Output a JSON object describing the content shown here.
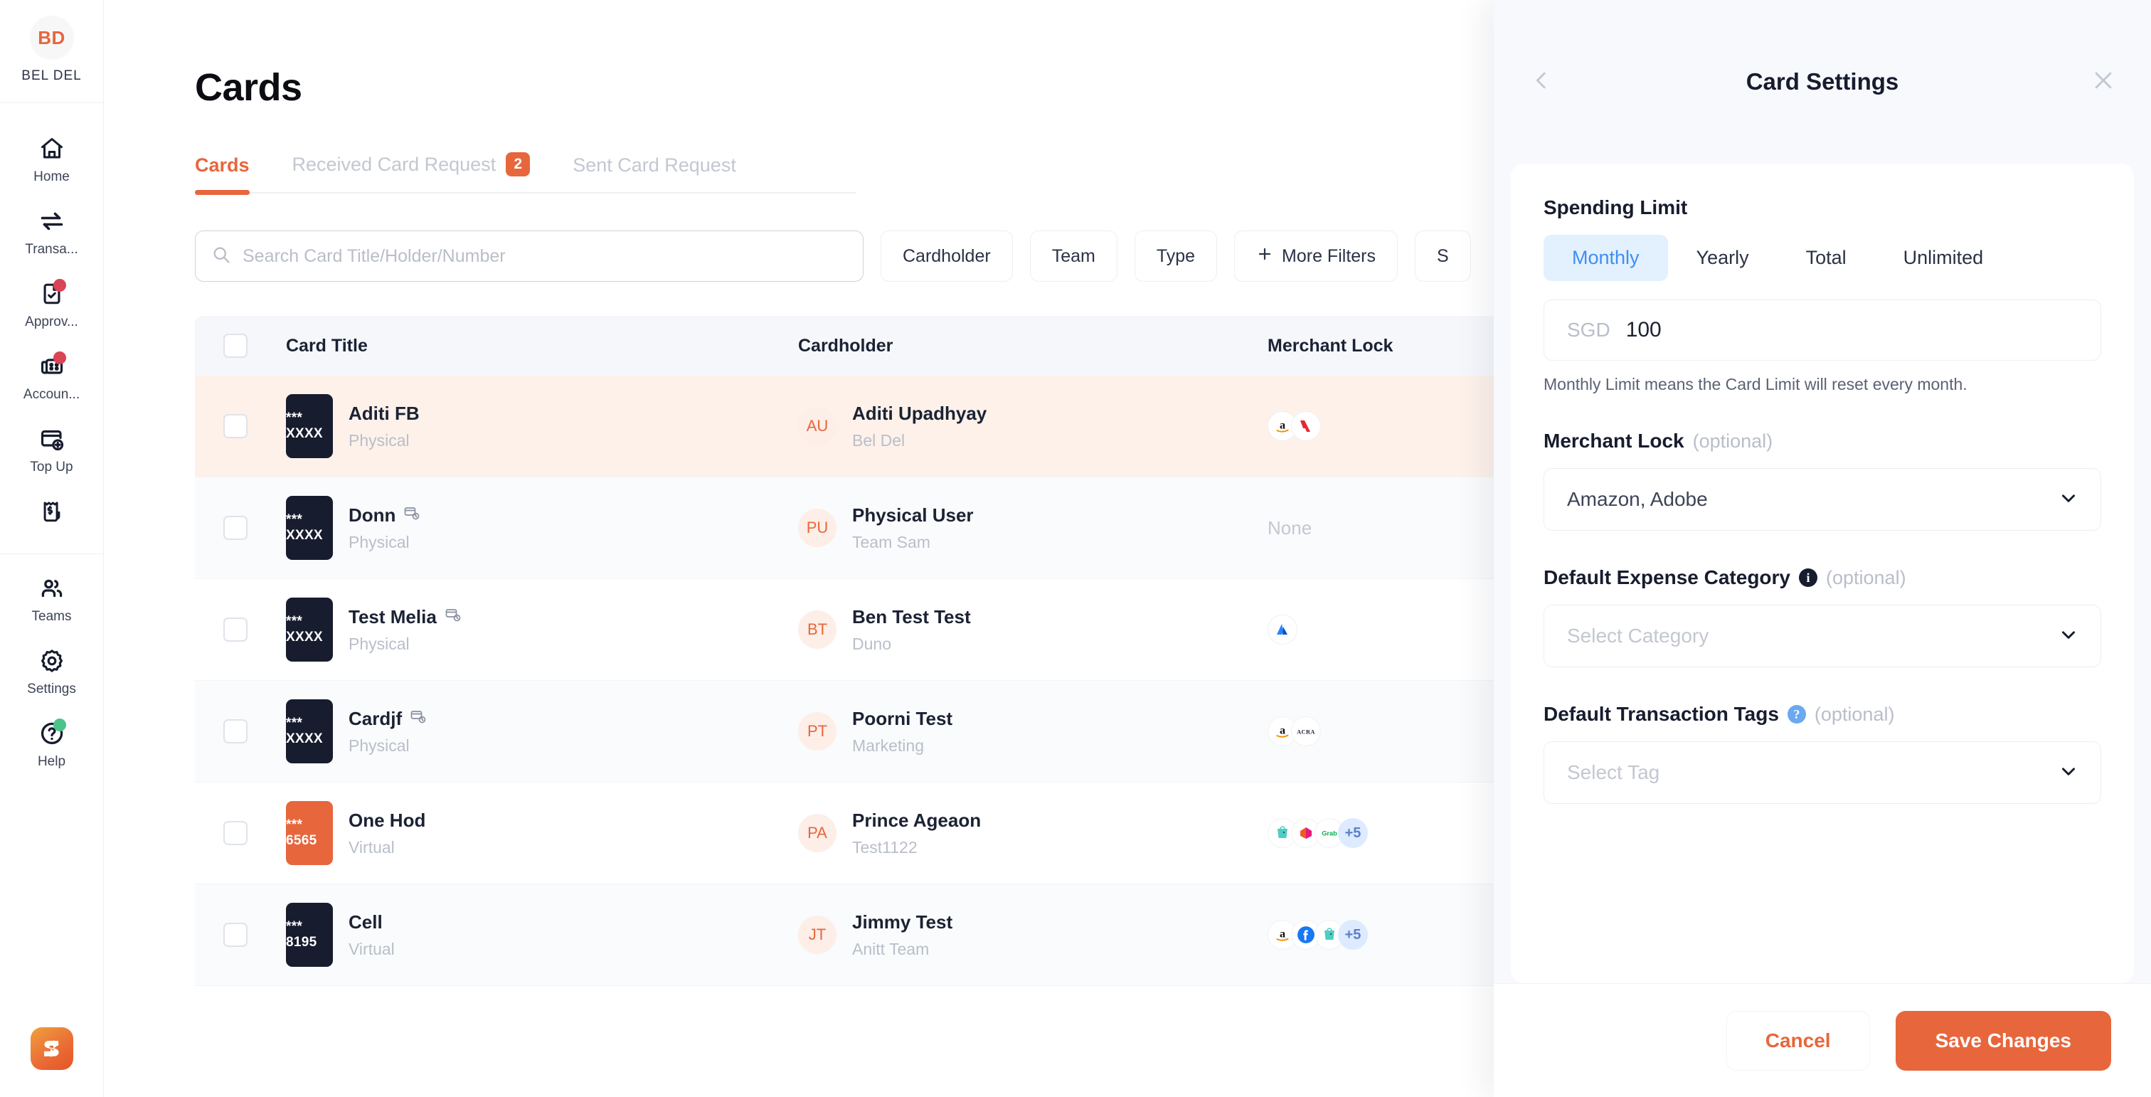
{
  "sidebar": {
    "org": {
      "initials": "BD",
      "name": "BEL DEL"
    },
    "items": [
      {
        "label": "Home",
        "icon": "home-icon",
        "badge": false
      },
      {
        "label": "Transa...",
        "icon": "transfer-arrows-icon",
        "badge": false
      },
      {
        "label": "Approv...",
        "icon": "document-check-icon",
        "badge": true
      },
      {
        "label": "Accoun...",
        "icon": "invoice-icon",
        "badge": true
      },
      {
        "label": "Top Up",
        "icon": "card-plus-icon",
        "badge": false
      },
      {
        "label": "",
        "icon": "receipt-dollar-icon",
        "badge": false
      },
      {
        "label": "Teams",
        "icon": "people-icon",
        "badge": false
      },
      {
        "label": "Settings",
        "icon": "gear-icon",
        "badge": false
      },
      {
        "label": "Help",
        "icon": "help-circle-icon",
        "badge": "green"
      }
    ],
    "brand_logo": "spenmo-s-logo"
  },
  "main": {
    "page_title": "Cards",
    "tabs": [
      {
        "label": "Cards",
        "badge": "",
        "active": true
      },
      {
        "label": "Received Card Request",
        "badge": "2",
        "active": false
      },
      {
        "label": "Sent Card Request",
        "badge": "",
        "active": false
      }
    ],
    "search": {
      "placeholder": "Search Card Title/Holder/Number",
      "value": "",
      "icon": "search-icon"
    },
    "filters": [
      {
        "label": "Cardholder",
        "icon": ""
      },
      {
        "label": "Team",
        "icon": ""
      },
      {
        "label": "Type",
        "icon": ""
      },
      {
        "label": "More Filters",
        "icon": "plus-icon"
      },
      {
        "label": "S",
        "icon": ""
      }
    ],
    "table": {
      "columns": [
        "Card Title",
        "Cardholder",
        "Merchant Lock"
      ],
      "rows": [
        {
          "card_mask": "*** XXXX",
          "card_color": "dark",
          "title": "Aditi FB",
          "has_title_icon": false,
          "type": "Physical",
          "holder_initials": "AU",
          "holder_name": "Aditi Upadhyay",
          "holder_team": "Bel Del",
          "merchants": [
            "amazon",
            "adobe"
          ],
          "merchant_more": "",
          "merchant_none": "",
          "state": "selected"
        },
        {
          "card_mask": "*** XXXX",
          "card_color": "dark",
          "title": "Donn",
          "has_title_icon": true,
          "type": "Physical",
          "holder_initials": "PU",
          "holder_name": "Physical User",
          "holder_team": "Team Sam",
          "merchants": [],
          "merchant_more": "",
          "merchant_none": "None",
          "state": "alt"
        },
        {
          "card_mask": "*** XXXX",
          "card_color": "dark",
          "title": "Test Melia",
          "has_title_icon": true,
          "type": "Physical",
          "holder_initials": "BT",
          "holder_name": "Ben Test Test",
          "holder_team": "Duno",
          "merchants": [
            "atlassian"
          ],
          "merchant_more": "",
          "merchant_none": "",
          "state": "plain"
        },
        {
          "card_mask": "*** XXXX",
          "card_color": "dark",
          "title": "Cardjf",
          "has_title_icon": true,
          "type": "Physical",
          "holder_initials": "PT",
          "holder_name": "Poorni Test",
          "holder_team": "Marketing",
          "merchants": [
            "amazon",
            "acra"
          ],
          "merchant_more": "",
          "merchant_none": "",
          "state": "alt"
        },
        {
          "card_mask": "*** 6565",
          "card_color": "orange",
          "title": "One Hod",
          "has_title_icon": false,
          "type": "Virtual",
          "holder_initials": "PA",
          "holder_name": "Prince Ageaon",
          "holder_team": "Test1122",
          "merchants": [
            "shopee",
            "lazada",
            "grab"
          ],
          "merchant_more": "+5",
          "merchant_none": "",
          "state": "plain"
        },
        {
          "card_mask": "*** 8195",
          "card_color": "dark",
          "title": "Cell",
          "has_title_icon": false,
          "type": "Virtual",
          "holder_initials": "JT",
          "holder_name": "Jimmy Test",
          "holder_team": "Anitt Team",
          "merchants": [
            "amazon",
            "facebook",
            "shopee"
          ],
          "merchant_more": "+5",
          "merchant_none": "",
          "state": "alt"
        }
      ]
    }
  },
  "panel": {
    "title": "Card Settings",
    "back_icon": "chevron-left-icon",
    "close_icon": "close-icon",
    "spending_limit": {
      "label": "Spending Limit",
      "options": [
        "Monthly",
        "Yearly",
        "Total",
        "Unlimited"
      ],
      "selected": "Monthly",
      "currency": "SGD",
      "amount": "100",
      "hint": "Monthly Limit means the Card Limit will reset every month."
    },
    "merchant_lock": {
      "label": "Merchant Lock",
      "optional": "(optional)",
      "value": "Amazon, Adobe"
    },
    "expense_category": {
      "label": "Default Expense Category",
      "optional": "(optional)",
      "placeholder": "Select Category",
      "info_icon": "info-icon"
    },
    "transaction_tags": {
      "label": "Default Transaction Tags",
      "optional": "(optional)",
      "placeholder": "Select Tag",
      "info_icon": "question-icon"
    },
    "footer": {
      "cancel": "Cancel",
      "save": "Save Changes"
    }
  },
  "colors": {
    "accent": "#e8663c",
    "dark": "#171c2e",
    "blue": "#3e8ef3",
    "badge_red": "#d94457",
    "badge_green": "#4cc38a"
  }
}
